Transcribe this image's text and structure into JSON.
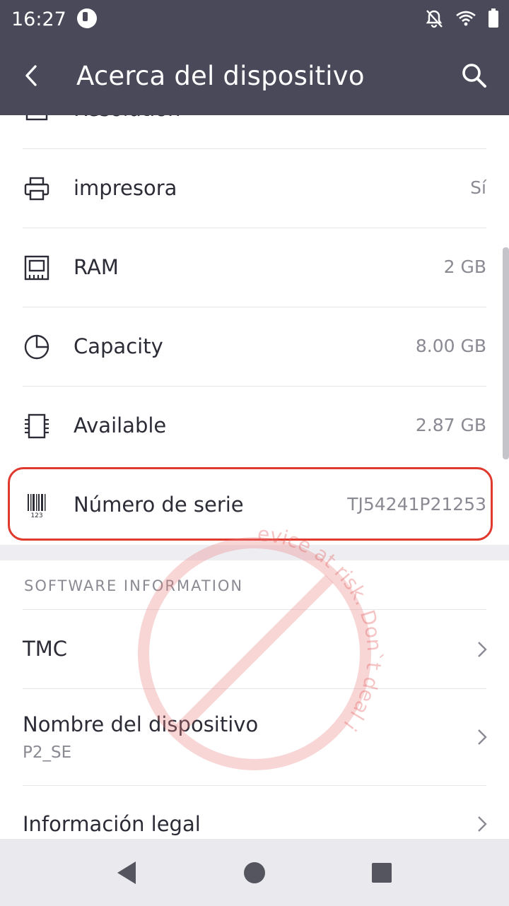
{
  "status_bar": {
    "time": "16:27",
    "icons": [
      "app-notification-icon",
      "bell-off-icon",
      "wifi-icon",
      "battery-icon"
    ]
  },
  "toolbar": {
    "title": "Acerca del dispositivo",
    "back_icon": "arrow-back-icon",
    "search_icon": "search-icon"
  },
  "hardware_items": [
    {
      "label": "Resolution",
      "value": "",
      "icon": "resolution-icon"
    },
    {
      "label": "impresora",
      "value": "Sí",
      "icon": "printer-icon"
    },
    {
      "label": "RAM",
      "value": "2 GB",
      "icon": "ram-icon"
    },
    {
      "label": "Capacity",
      "value": "8.00 GB",
      "icon": "pie-chart-icon"
    },
    {
      "label": "Available",
      "value": "2.87 GB",
      "icon": "chip-icon"
    },
    {
      "label": "Número de serie",
      "value": "TJ54241P21253",
      "icon": "barcode-icon"
    }
  ],
  "software_section": {
    "header": "SOFTWARE INFORMATION",
    "items": [
      {
        "label": "TMC",
        "sublabel": ""
      },
      {
        "label": "Nombre del dispositivo",
        "sublabel": "P2_SE"
      },
      {
        "label": "Información legal",
        "sublabel": ""
      }
    ]
  },
  "watermark": {
    "text": "This device at risk. Don`t deal i"
  },
  "colors": {
    "header_bg": "#4a4959",
    "highlight": "#e0392e",
    "divider": "#e5e5ea",
    "secondary_text": "#8a8a93"
  }
}
